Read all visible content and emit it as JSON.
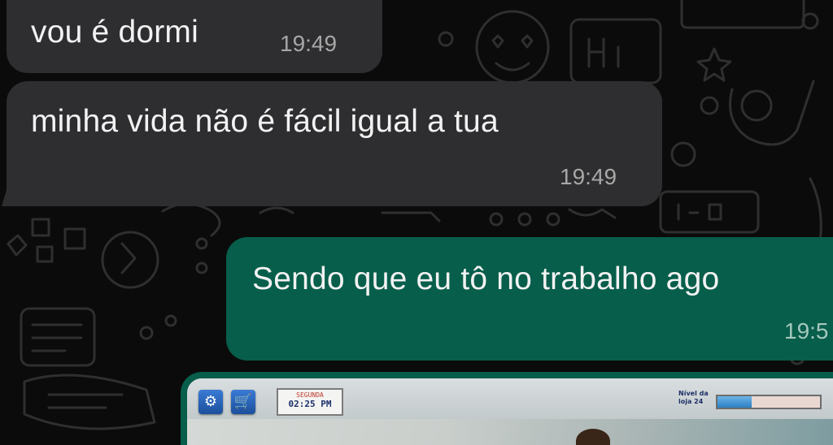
{
  "messages": [
    {
      "direction": "incoming",
      "text": "vou é dormi",
      "time": "19:49"
    },
    {
      "direction": "incoming",
      "text": "minha vida não é fácil igual a tua",
      "time": "19:49"
    },
    {
      "direction": "outgoing",
      "text": "Sendo que eu tô no trabalho ago",
      "time": "19:5"
    }
  ],
  "image_message": {
    "game_hud": {
      "settings_icon": "gear-icon",
      "shop_icon": "cart-icon",
      "clock_day": "SEGUNDA",
      "clock_time": "02:25 PM",
      "level_label": "Nível da loja 24",
      "level_progress": 0.33
    }
  },
  "colors": {
    "background": "#0b0b0b",
    "incoming_bubble": "#2e2e30",
    "outgoing_bubble": "#075e4b",
    "text": "#f2f2f2",
    "timestamp": "#a7a7a7"
  }
}
